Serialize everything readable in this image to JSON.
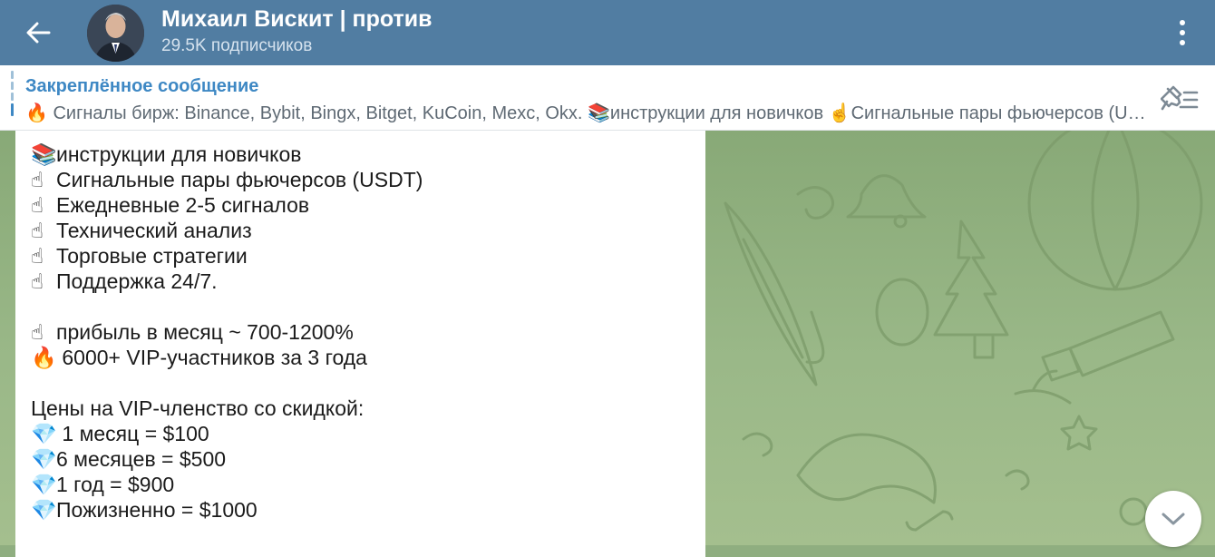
{
  "header": {
    "title": "Михаил Вискит | против",
    "subtitle": "29.5K подписчиков"
  },
  "pinned": {
    "title": "Закреплённое сообщение",
    "text": "🔥 Сигналы бирж: Binance, Bybit, Bingx, Bitget, KuCoin, Mexc, Okx.  📚инструкции для новичков ☝️Сигнальные пары фьючерсов (USDT)"
  },
  "message": {
    "lines": [
      {
        "emoji": "📚",
        "text": "инструкции для новичков"
      },
      {
        "emoji": "☝",
        "text": "Сигнальные пары фьючерсов (USDT)"
      },
      {
        "emoji": "☝",
        "text": "Ежедневные 2-5 сигналов"
      },
      {
        "emoji": "☝",
        "text": "Технический анализ"
      },
      {
        "emoji": "☝",
        "text": "Торговые стратегии"
      },
      {
        "emoji": "☝",
        "text": "Поддержка 24/7."
      },
      {
        "emoji": "",
        "text": ""
      },
      {
        "emoji": "☝",
        "text": "прибыль в месяц ~ 700-1200%"
      },
      {
        "emoji": "🔥",
        "text": " 6000+ VIP-участников за 3 года"
      },
      {
        "emoji": "",
        "text": ""
      },
      {
        "emoji": "",
        "text": "Цены на VIP-членство со скидкой:"
      },
      {
        "emoji": "💎",
        "text": " 1 месяц = $100"
      },
      {
        "emoji": "💎",
        "text": "6 месяцев = $500"
      },
      {
        "emoji": "💎",
        "text": "1 год = $900"
      },
      {
        "emoji": "💎",
        "text": "Пожизненно = $1000"
      }
    ]
  },
  "icons": {
    "back": "arrow-left-icon",
    "more": "more-vertical-icon",
    "unpin": "pin-list-icon",
    "scroll_down": "chevron-down-icon"
  },
  "colors": {
    "header_bg": "#517da2",
    "accent": "#3e88c4",
    "chat_bg": "#8fae80"
  }
}
